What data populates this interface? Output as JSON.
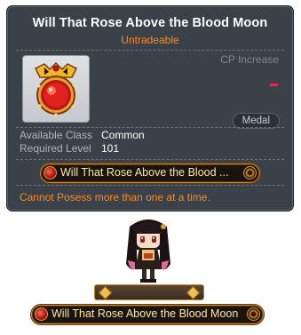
{
  "tooltip": {
    "title": "Will That Rose Above the Blood Moon",
    "tradeability": "Untradeable",
    "cp_label": "CP Increase",
    "cp_value": "-",
    "category_badge": "Medal",
    "requirements": [
      {
        "label": "Available Class",
        "value": "Common"
      },
      {
        "label": "Required Level",
        "value": "101"
      }
    ],
    "medal_name_truncated": "Will That Rose Above the Blood  ...",
    "note": "Cannot Posess more than one at a time.",
    "icon": "blood-moon-medal-icon"
  },
  "character": {
    "medal_name": "Will That Rose Above the Blood Moon"
  },
  "colors": {
    "panel_bg": "#3a4149",
    "title": "#ffffff",
    "accent_orange": "#ff8a1e",
    "cp_value_red": "#ff1d55",
    "medal_text": "#ffe7a0",
    "medal_border": "#c48a27"
  }
}
